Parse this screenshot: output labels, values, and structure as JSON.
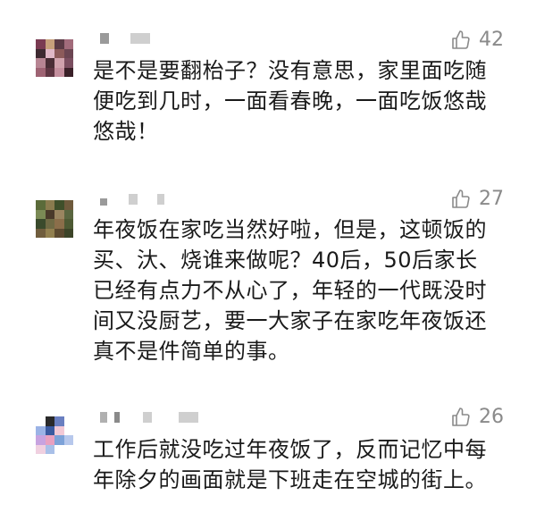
{
  "comments": [
    {
      "likes": "42",
      "text": "是不是要翻枱子？没有意思，家里面吃随\n便吃到几时，一面看春晚，一面吃饭悠哉\n悠哉！",
      "avatar_colors": [
        "#7a3b52",
        "#c7a07b",
        "#5b3a45",
        "#a26b7b",
        "#3e2a31",
        "#e0b8c7",
        "#8c5a5a",
        "#6b4552",
        "#b78593",
        "#4a2e36",
        "#d0a2ad",
        "#7b4e60",
        "#9e6373",
        "#5f3643",
        "#c48f9e",
        "#3a2028"
      ]
    },
    {
      "likes": "27",
      "text": "年夜饭在家吃当然好啦，但是，这顿饭的\n买、汏、烧谁来做呢？40后，50后家长\n已经有点力不从心了，年轻的一代既没时\n间又没厨艺，要一大家子在家吃年夜饭还\n真不是件简单的事。",
      "avatar_colors": [
        "#5b6b3a",
        "#8a7b4e",
        "#3f4f2a",
        "#6e5a3c",
        "#7b8a55",
        "#4a3a2a",
        "#9a8560",
        "#5a6640",
        "#3a4a2c",
        "#6f6a44",
        "#8b6e4a",
        "#4e5a34",
        "#705d3d",
        "#92804f",
        "#5c4a30",
        "#3c4428"
      ]
    },
    {
      "likes": "26",
      "text": "工作后就没吃过年夜饭了，反而记忆中每\n年除夕的画面就是下班走在空城的街上。",
      "avatar_colors": [
        "#ffffff",
        "#2a2a2a",
        "#6a7fc0",
        "#ffffff",
        "#9bb3e6",
        "#3a5aa0",
        "#f2c9d6",
        "#ffffff",
        "#c7a3e0",
        "#e8a0c0",
        "#7da2d8",
        "#b7c8ec",
        "#f0d0e0",
        "#a9c0e8",
        "#ffffff",
        "#ffffff"
      ]
    }
  ]
}
